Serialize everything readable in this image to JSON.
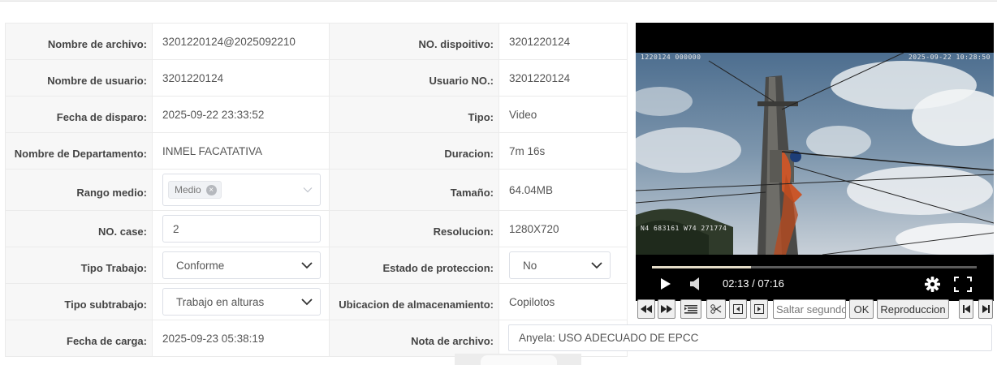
{
  "fields": {
    "nombre_archivo": {
      "label": "Nombre de archivo:",
      "value": "3201220124@2025092210"
    },
    "no_dispositivo": {
      "label": "NO. dispoitivo:",
      "value": "3201220124"
    },
    "nombre_usuario": {
      "label": "Nombre de usuario:",
      "value": "3201220124"
    },
    "usuario_no": {
      "label": "Usuario NO.:",
      "value": "3201220124"
    },
    "fecha_disparo": {
      "label": "Fecha de disparo:",
      "value": "2025-09-22 23:33:52"
    },
    "tipo": {
      "label": "Tipo:",
      "value": "Video"
    },
    "nombre_departamento": {
      "label": "Nombre de Departamento:",
      "value": "INMEL FACATATIVA"
    },
    "duracion": {
      "label": "Duracion:",
      "value": "7m 16s"
    },
    "rango_medio": {
      "label": "Rango medio:",
      "tag": "Medio"
    },
    "tamano": {
      "label": "Tamaño:",
      "value": "64.04MB"
    },
    "no_case": {
      "label": "NO. case:",
      "value": "2"
    },
    "resolucion": {
      "label": "Resolucion:",
      "value": "1280X720"
    },
    "tipo_trabajo": {
      "label": "Tipo Trabajo:",
      "value": "Conforme"
    },
    "estado_proteccion": {
      "label": "Estado de proteccion:",
      "value": "No"
    },
    "tipo_subtrabajo": {
      "label": "Tipo subtrabajo:",
      "value": "Trabajo en alturas"
    },
    "ubicacion": {
      "label": "Ubicacion de almacenamiento:",
      "value": "Copilotos"
    },
    "fecha_carga": {
      "label": "Fecha de carga:",
      "value": "2025-09-23 05:38:19"
    },
    "nota_archivo": {
      "label": "Nota de archivo:",
      "value": "Anyela: USO ADECUADO DE EPCC"
    }
  },
  "player": {
    "osd_device": "1220124 000000",
    "osd_datetime": "2025-09-22  10:28:50",
    "osd_gps": "N4 683161  W74 271774",
    "current_time": "02:13",
    "total_time": "07:16",
    "time_display": "02:13 / 07:16",
    "progress": 0.305,
    "play_icon": "play-icon",
    "volume_icon": "volume-icon",
    "settings_icon": "gear-icon",
    "fullscreen_icon": "fullscreen-icon"
  },
  "toolbar": {
    "jump_placeholder": "Saltar segundos",
    "ok_label": "OK",
    "playback_label": "Reproduccion"
  }
}
